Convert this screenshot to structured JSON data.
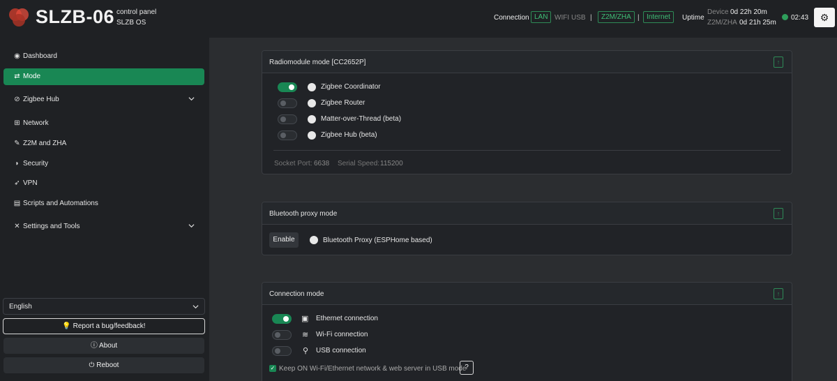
{
  "header": {
    "brand": "SLZB-06",
    "subtitle_line1": "control panel",
    "subtitle_line2": "SLZB OS",
    "connection_label": "Connection",
    "conn_lan": "LAN",
    "conn_wifi": "WIFI",
    "conn_usb": "USB",
    "separator": "|",
    "mode_z2m": "Z2M/ZHA",
    "internet": "Internet",
    "uptime_label": "Uptime",
    "device_label": "Device",
    "device_uptime": "0d 22h 20m",
    "z2m_label": "Z2M/ZHA",
    "z2m_uptime": "0d 21h 25m",
    "time": "02:43",
    "accent_color": "#198754"
  },
  "sidebar": {
    "items": [
      {
        "label": "Dashboard",
        "icon": "dashboard-icon"
      },
      {
        "label": "Mode",
        "icon": "arrows-swap-icon",
        "active": true
      },
      {
        "label": "Zigbee Hub",
        "icon": "zigbee-icon",
        "expandable": true
      },
      {
        "label": "Network",
        "icon": "network-icon"
      },
      {
        "label": "Z2M and ZHA",
        "icon": "tools-icon"
      },
      {
        "label": "Security",
        "icon": "shield-icon"
      },
      {
        "label": "VPN",
        "icon": "rocket-icon"
      },
      {
        "label": "Scripts and Automations",
        "icon": "script-icon"
      },
      {
        "label": "Settings and Tools",
        "icon": "wrench-icon",
        "expandable": true
      }
    ],
    "language": "English",
    "report_button": "Report a bug/feedback!",
    "about_button": "About",
    "reboot_button": "Reboot"
  },
  "radiomodule": {
    "title": "Radiomodule mode [CC2652P]",
    "options": [
      {
        "label": "Zigbee Coordinator",
        "on": true
      },
      {
        "label": "Zigbee Router",
        "on": false
      },
      {
        "label": "Matter-over-Thread (beta)",
        "on": false
      },
      {
        "label": "Zigbee Hub (beta)",
        "on": false
      }
    ],
    "socket_port_label": "Socket Port:",
    "socket_port_value": "6638",
    "serial_speed_label": "Serial Speed:",
    "serial_speed_value": "115200"
  },
  "bluetooth": {
    "title": "Bluetooth proxy mode",
    "enable_button": "Enable",
    "proxy_label": "Bluetooth Proxy (ESPHome based)"
  },
  "connection": {
    "title": "Connection mode",
    "options": [
      {
        "label": "Ethernet connection",
        "on": true
      },
      {
        "label": "Wi-Fi connection",
        "on": false
      },
      {
        "label": "USB connection",
        "on": false
      }
    ],
    "keep_on_label": "Keep ON Wi-Fi/Ethernet network & web server in USB mode",
    "keep_on_checked": true,
    "help_button": "?"
  },
  "collapse_glyph": "↑",
  "checkmark": "✓"
}
